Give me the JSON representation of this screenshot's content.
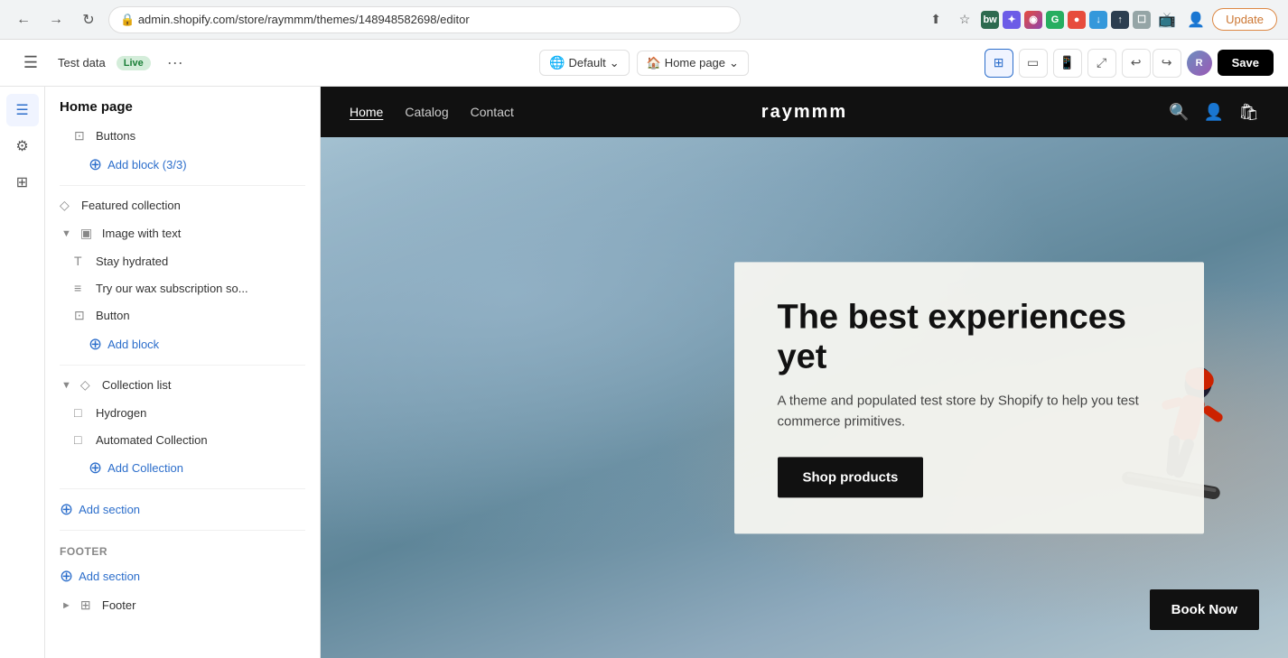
{
  "browser": {
    "back_label": "←",
    "forward_label": "→",
    "refresh_label": "↺",
    "address": "admin.shopify.com/store/raymmm/themes/148948582698/editor",
    "update_label": "Update"
  },
  "app_header": {
    "store_name": "Test data",
    "live_label": "Live",
    "more_label": "···",
    "default_label": "Default",
    "homepage_label": "Home page",
    "save_label": "Save"
  },
  "sidebar": {
    "page_title": "Home page",
    "sections": [
      {
        "id": "buttons",
        "label": "Buttons",
        "icon": "⊡",
        "level": 1
      },
      {
        "id": "add-block",
        "label": "Add block (3/3)",
        "icon": "+",
        "level": 2,
        "type": "add"
      },
      {
        "id": "featured-collection",
        "label": "Featured collection",
        "icon": "◇",
        "level": 0
      },
      {
        "id": "image-with-text",
        "label": "Image with text",
        "icon": "▣",
        "level": 0,
        "collapsible": true,
        "collapsed": false
      },
      {
        "id": "stay-hydrated",
        "label": "Stay hydrated",
        "icon": "T",
        "level": 1
      },
      {
        "id": "wax-subscription",
        "label": "Try our wax subscription so...",
        "icon": "≡",
        "level": 1
      },
      {
        "id": "button",
        "label": "Button",
        "icon": "⊡",
        "level": 1
      },
      {
        "id": "add-block-2",
        "label": "Add block",
        "icon": "+",
        "level": 2,
        "type": "add"
      },
      {
        "id": "collection-list",
        "label": "Collection list",
        "icon": "◇",
        "level": 0,
        "collapsible": true,
        "collapsed": false
      },
      {
        "id": "hydrogen",
        "label": "Hydrogen",
        "icon": "□",
        "level": 1
      },
      {
        "id": "automated-collection",
        "label": "Automated Collection",
        "icon": "□",
        "level": 1
      },
      {
        "id": "add-collection",
        "label": "Add Collection",
        "icon": "+",
        "level": 2,
        "type": "add"
      },
      {
        "id": "add-section-1",
        "label": "Add section",
        "icon": "+",
        "level": 0,
        "type": "add"
      }
    ],
    "footer_label": "Footer",
    "footer_sections": [
      {
        "id": "footer-add-section",
        "label": "Add section",
        "icon": "+",
        "type": "add"
      },
      {
        "id": "footer-item",
        "label": "Footer",
        "icon": "⊞",
        "collapsible": true
      }
    ]
  },
  "store_preview": {
    "nav": {
      "links": [
        "Home",
        "Catalog",
        "Contact"
      ],
      "active_link": "Home",
      "brand": "raymmm"
    },
    "hero": {
      "title": "The best experiences yet",
      "subtitle": "A theme and populated test store by Shopify to help you test commerce primitives.",
      "cta_label": "Shop products",
      "book_now_label": "Book Now"
    }
  }
}
